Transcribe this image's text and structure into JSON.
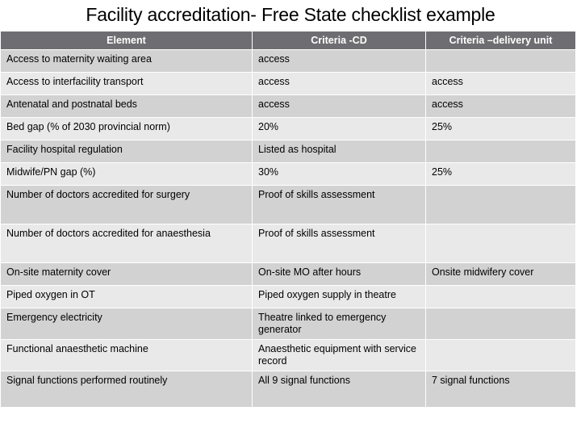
{
  "slide": {
    "title": "Facility accreditation- Free State checklist example"
  },
  "table": {
    "headers": [
      "Element",
      "Criteria -CD",
      "Criteria –delivery unit"
    ],
    "rows": [
      {
        "element": "Access to maternity waiting area",
        "criteria_cd": "access",
        "criteria_du": ""
      },
      {
        "element": "Access to interfacility transport",
        "criteria_cd": "access",
        "criteria_du": "access"
      },
      {
        "element": "Antenatal and postnatal  beds",
        "criteria_cd": "access",
        "criteria_du": "access"
      },
      {
        "element": "Bed gap (% of 2030 provincial norm)",
        "criteria_cd": "20%",
        "criteria_du": "25%"
      },
      {
        "element": "Facility hospital regulation",
        "criteria_cd": "Listed  as hospital",
        "criteria_du": ""
      },
      {
        "element": "Midwife/PN gap (%)",
        "criteria_cd": "30%",
        "criteria_du": "25%"
      },
      {
        "element": "Number of doctors accredited for surgery",
        "criteria_cd": "Proof of skills assessment",
        "criteria_du": ""
      },
      {
        "element": "Number of doctors accredited for anaesthesia",
        "criteria_cd": "Proof of skills assessment",
        "criteria_du": ""
      },
      {
        "element": "On-site maternity cover",
        "criteria_cd": "On-site MO after hours",
        "criteria_du": "Onsite midwifery cover"
      },
      {
        "element": "Piped oxygen in OT",
        "criteria_cd": "Piped oxygen supply in theatre",
        "criteria_du": ""
      },
      {
        "element": "Emergency electricity",
        "criteria_cd": "Theatre linked to emergency generator",
        "criteria_du": ""
      },
      {
        "element": "Functional anaesthetic machine",
        "criteria_cd": "Anaesthetic equipment with service record",
        "criteria_du": ""
      },
      {
        "element": "Signal functions performed routinely",
        "criteria_cd": "All 9 signal functions",
        "criteria_du": "7 signal functions"
      }
    ]
  },
  "colors": {
    "header_bg": "#6e6e72",
    "header_text": "#ffffff",
    "band_dark": "#d2d2d2",
    "band_light": "#e9e9e9",
    "page_bg": "#ffffff",
    "body_text": "#000000"
  }
}
